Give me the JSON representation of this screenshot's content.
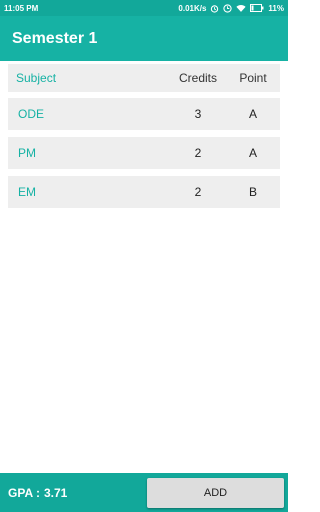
{
  "status_bar": {
    "time": "11:05 PM",
    "speed": "0.01K/s",
    "battery": "11%",
    "icons": [
      "alarm-icon",
      "clock-icon",
      "wifi-icon",
      "battery-icon"
    ]
  },
  "app_bar": {
    "title": "Semester 1"
  },
  "table": {
    "headers": {
      "subject": "Subject",
      "credits": "Credits",
      "point": "Point"
    },
    "rows": [
      {
        "subject": "ODE",
        "credits": "3",
        "point": "A"
      },
      {
        "subject": "PM",
        "credits": "2",
        "point": "A"
      },
      {
        "subject": "EM",
        "credits": "2",
        "point": "B"
      }
    ]
  },
  "footer": {
    "gpa_label": "GPA :",
    "gpa_value": "3.71",
    "add_label": "ADD"
  },
  "colors": {
    "primary": "#16b2a4",
    "primary_dark": "#12a89a",
    "row_bg": "#eeeeee"
  }
}
